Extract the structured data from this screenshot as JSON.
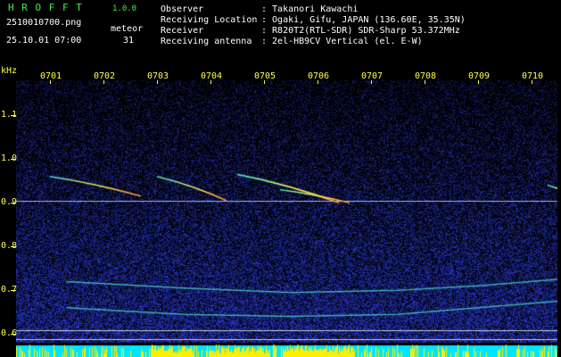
{
  "header": {
    "app_name": "H R O F F T",
    "version": "1.0.0",
    "filename": "2510010700.png",
    "type_label": "meteor",
    "datetime": "25.10.01 07:00",
    "count": "31",
    "info": [
      {
        "label": "Observer",
        "value": ": Takanori Kawachi"
      },
      {
        "label": "Receiving Location",
        "value": ": Ogaki, Gifu, JAPAN (136.60E, 35.35N)"
      },
      {
        "label": "Receiver",
        "value": ": R820T2(RTL-SDR) SDR-Sharp 53.372MHz"
      },
      {
        "label": "Receiving antenna",
        "value": ": 2el-HB9CV Vertical (el. E-W)"
      }
    ]
  },
  "y_axis": {
    "unit": "kHz",
    "ticks": [
      "1.1",
      "1.0",
      "0.9",
      "0.8",
      "0.7",
      "0.6"
    ],
    "tick_values": [
      1.1,
      1.0,
      0.9,
      0.8,
      0.7,
      0.6
    ],
    "range": [
      0.58,
      1.18
    ]
  },
  "x_axis": {
    "ticks": [
      "0701",
      "0702",
      "0703",
      "0704",
      "0705",
      "0706",
      "0707",
      "0708",
      "0709",
      "0710"
    ],
    "range_minutes": [
      0,
      10
    ]
  },
  "colors": {
    "background": "#000000",
    "header_green": "#44ee44",
    "axis_yellow": "#ffff44",
    "noise_blue": "#1a2a8a",
    "trace_cyan": "#40e0d0",
    "bar_cyan": "#00e5ff",
    "bar_yellow": "#ffee00"
  },
  "chart_data": {
    "type": "heatmap",
    "xlabel": "",
    "ylabel": "kHz",
    "ylim": [
      0.58,
      1.18
    ],
    "xlim": [
      0,
      10
    ],
    "carrier_khz": 0.905,
    "meteor_echoes": [
      {
        "x": [
          0.0,
          1.7
        ],
        "y": [
          0.96,
          0.915
        ]
      },
      {
        "x": [
          2.0,
          3.3
        ],
        "y": [
          0.96,
          0.905
        ]
      },
      {
        "x": [
          3.5,
          5.4
        ],
        "y": [
          0.965,
          0.9
        ]
      },
      {
        "x": [
          4.3,
          5.6
        ],
        "y": [
          0.93,
          0.9
        ]
      },
      {
        "x": [
          9.3,
          10.0
        ],
        "y": [
          0.94,
          0.905
        ]
      }
    ],
    "lower_bands": [
      {
        "x": [
          0.3,
          2.5,
          4.5,
          6.5,
          8.0,
          10.0
        ],
        "y": [
          0.66,
          0.645,
          0.64,
          0.645,
          0.66,
          0.68
        ]
      },
      {
        "x": [
          0.3,
          2.5,
          4.5,
          6.5,
          8.0,
          10.0
        ],
        "y": [
          0.72,
          0.705,
          0.695,
          0.7,
          0.71,
          0.73
        ]
      }
    ]
  }
}
